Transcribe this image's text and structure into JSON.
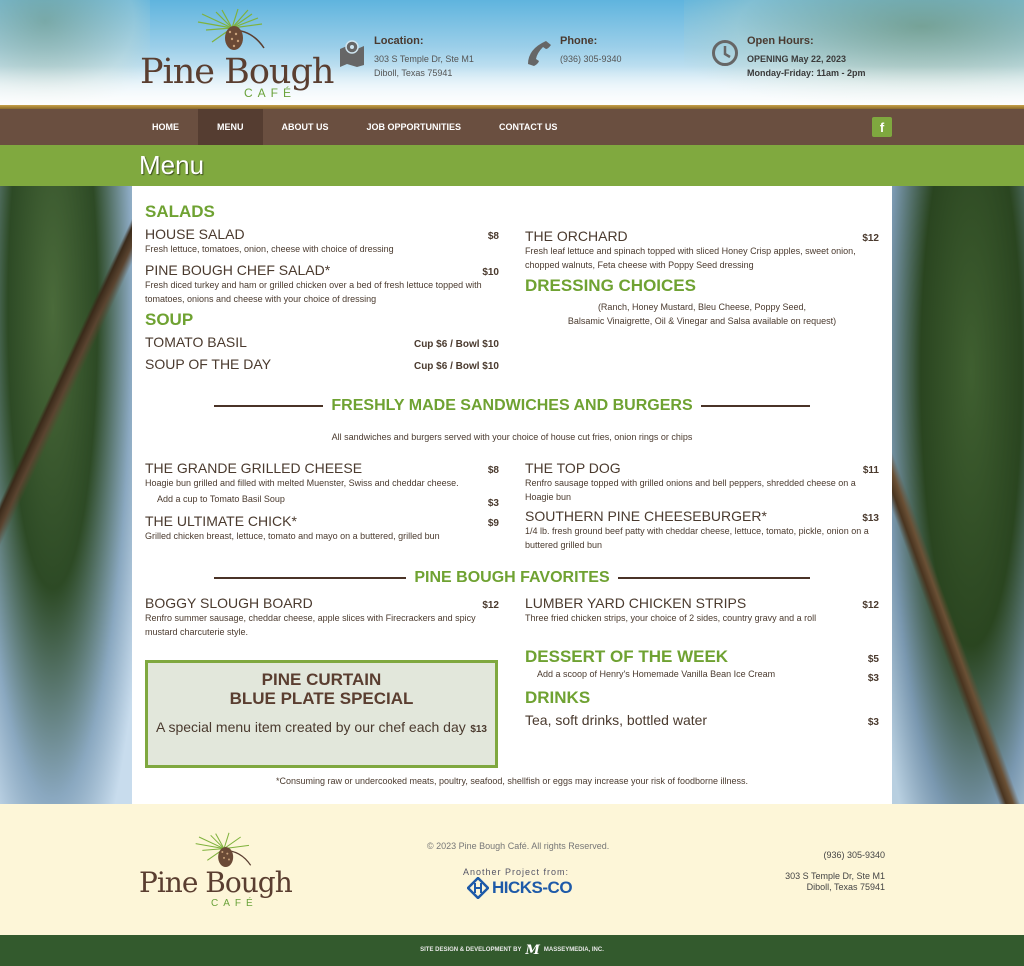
{
  "brand": {
    "name": "Pine Bough",
    "sub": "CAFÉ"
  },
  "header": {
    "location": {
      "label": "Location:",
      "line1": "303 S Temple Dr, Ste M1",
      "line2": "Diboll, Texas 75941",
      "icon": "map-pin-icon"
    },
    "phone": {
      "label": "Phone:",
      "value": "(936) 305-9340",
      "icon": "phone-icon"
    },
    "hours": {
      "label": "Open Hours:",
      "line1": "OPENING May 22, 2023",
      "line2": "Monday-Friday: 11am - 2pm",
      "icon": "clock-icon"
    }
  },
  "nav": {
    "items": [
      {
        "label": "HOME"
      },
      {
        "label": "MENU",
        "active": true
      },
      {
        "label": "ABOUT US"
      },
      {
        "label": "JOB OPPORTUNITIES"
      },
      {
        "label": "CONTACT US"
      }
    ],
    "facebook": "f"
  },
  "page_title": "Menu",
  "menu": {
    "salads": {
      "title": "SALADS",
      "items": [
        {
          "name": "HOUSE SALAD",
          "price": "$8",
          "desc": "Fresh lettuce, tomatoes, onion, cheese with choice of dressing"
        },
        {
          "name": "PINE BOUGH CHEF SALAD*",
          "price": "$10",
          "desc": "Fresh diced turkey and ham or grilled chicken over a bed of fresh lettuce topped with tomatoes, onions and cheese with your choice of dressing"
        },
        {
          "name": "THE ORCHARD",
          "price": "$12",
          "desc": "Fresh leaf lettuce and spinach topped with sliced Honey Crisp apples, sweet onion, chopped walnuts, Feta cheese with Poppy Seed dressing"
        }
      ]
    },
    "dressing": {
      "title": "DRESSING CHOICES",
      "line1": "(Ranch, Honey Mustard, Bleu Cheese, Poppy Seed,",
      "line2": "Balsamic Vinaigrette, Oil & Vinegar and Salsa available on request)"
    },
    "soup": {
      "title": "SOUP",
      "items": [
        {
          "name": "TOMATO BASIL",
          "price": "Cup $6 / Bowl $10"
        },
        {
          "name": "SOUP OF THE DAY",
          "price": "Cup $6 / Bowl $10"
        }
      ]
    },
    "sandwiches": {
      "title": "FRESHLY MADE SANDWICHES AND BURGERS",
      "note": "All sandwiches and burgers served with your choice of house cut fries, onion rings or chips",
      "items": [
        {
          "name": "THE GRANDE GRILLED CHEESE",
          "price": "$8",
          "desc": "Hoagie bun grilled and filled with melted Muenster, Swiss and cheddar cheese.",
          "addon": "Add a cup to Tomato Basil Soup",
          "addon_price": "$3"
        },
        {
          "name": "THE ULTIMATE CHICK*",
          "price": "$9",
          "desc": "Grilled chicken breast, lettuce, tomato and mayo on a buttered, grilled bun"
        },
        {
          "name": "THE TOP DOG",
          "price": "$11",
          "desc": "Renfro sausage topped with grilled onions and bell peppers, shredded cheese on a Hoagie bun"
        },
        {
          "name": "SOUTHERN PINE CHEESEBURGER*",
          "price": "$13",
          "desc": "1/4 lb. fresh ground beef patty with cheddar cheese, lettuce, tomato, pickle, onion on a buttered grilled bun"
        }
      ]
    },
    "favorites": {
      "title": "PINE BOUGH FAVORITES",
      "items": [
        {
          "name": "BOGGY SLOUGH BOARD",
          "price": "$12",
          "desc": "Renfro summer sausage, cheddar cheese, apple slices with Firecrackers and spicy mustard charcuterie style."
        },
        {
          "name": "LUMBER YARD CHICKEN STRIPS",
          "price": "$12",
          "desc": "Three fried chicken strips, your choice of 2 sides, country gravy and a roll"
        }
      ]
    },
    "special": {
      "title1": "PINE CURTAIN",
      "title2": "BLUE PLATE SPECIAL",
      "desc": "A special menu item created by our chef each day",
      "price": "$13"
    },
    "dessert": {
      "title": "DESSERT OF THE WEEK",
      "price": "$5",
      "addon": "Add a scoop of Henry's Homemade Vanilla Bean Ice Cream",
      "addon_price": "$3"
    },
    "drinks": {
      "title": "DRINKS",
      "item": "Tea, soft drinks, bottled water",
      "price": "$3"
    },
    "disclaimer": "*Consuming raw or undercooked meats, poultry, seafood, shellfish or eggs may increase your risk of foodborne illness."
  },
  "footer": {
    "copyright": "© 2023 Pine Bough Café. All rights Reserved.",
    "another_project": "Another Project from:",
    "partner": "HICKS-CO",
    "phone": "(936) 305-9340",
    "addr1": "303 S Temple Dr, Ste M1",
    "addr2": "Diboll, Texas 75941",
    "credit_prefix": "SITE DESIGN & DEVELOPMENT BY",
    "credit_mark": "M",
    "credit_name": "MASSEYMEDIA, INC."
  },
  "colors": {
    "green": "#80a93f",
    "brown": "#6a4f40",
    "title_green": "#6fa232",
    "footer_bg": "#fdf6d8",
    "bottom_bar": "#335a2d"
  }
}
